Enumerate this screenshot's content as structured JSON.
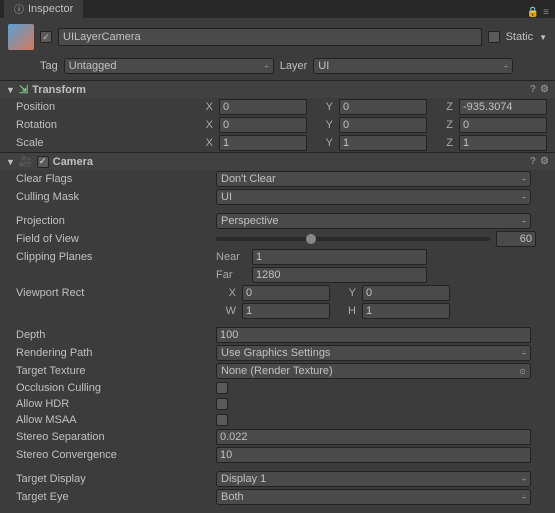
{
  "tab": {
    "title": "Inspector"
  },
  "header": {
    "enabled": true,
    "name": "UILayerCamera",
    "static_label": "Static",
    "static_checked": false,
    "tag_label": "Tag",
    "tag_value": "Untagged",
    "layer_label": "Layer",
    "layer_value": "UI"
  },
  "transform": {
    "title": "Transform",
    "position": {
      "label": "Position",
      "x": "0",
      "y": "0",
      "z": "-935.3074"
    },
    "rotation": {
      "label": "Rotation",
      "x": "0",
      "y": "0",
      "z": "0"
    },
    "scale": {
      "label": "Scale",
      "x": "1",
      "y": "1",
      "z": "1"
    }
  },
  "camera": {
    "title": "Camera",
    "enabled": true,
    "clear_flags": {
      "label": "Clear Flags",
      "value": "Don't Clear"
    },
    "culling_mask": {
      "label": "Culling Mask",
      "value": "UI"
    },
    "projection": {
      "label": "Projection",
      "value": "Perspective"
    },
    "fov": {
      "label": "Field of View",
      "value": "60"
    },
    "clipping": {
      "label": "Clipping Planes",
      "near_label": "Near",
      "near": "1",
      "far_label": "Far",
      "far": "1280"
    },
    "viewport": {
      "label": "Viewport Rect",
      "x": "0",
      "y": "0",
      "w": "1",
      "h": "1"
    },
    "depth": {
      "label": "Depth",
      "value": "100"
    },
    "rendering_path": {
      "label": "Rendering Path",
      "value": "Use Graphics Settings"
    },
    "target_texture": {
      "label": "Target Texture",
      "value": "None (Render Texture)"
    },
    "occlusion": {
      "label": "Occlusion Culling",
      "checked": false
    },
    "allow_hdr": {
      "label": "Allow HDR",
      "checked": false
    },
    "allow_msaa": {
      "label": "Allow MSAA",
      "checked": false
    },
    "stereo_sep": {
      "label": "Stereo Separation",
      "value": "0.022"
    },
    "stereo_conv": {
      "label": "Stereo Convergence",
      "value": "10"
    },
    "target_display": {
      "label": "Target Display",
      "value": "Display 1"
    },
    "target_eye": {
      "label": "Target Eye",
      "value": "Both"
    }
  }
}
